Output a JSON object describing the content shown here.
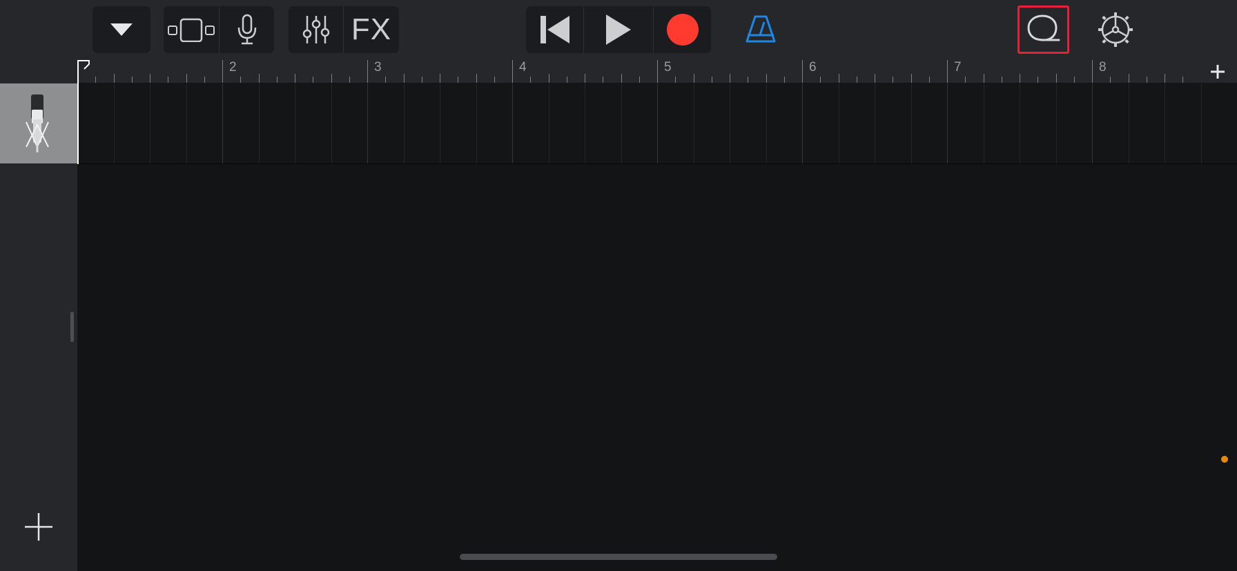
{
  "toolbar": {
    "fx_label": "FX",
    "buttons": {
      "browser": "browser-dropdown",
      "tracks_view": "tracks-view",
      "smart_control": "microphone",
      "mixer": "mixer-sliders",
      "fx": "fx",
      "rewind": "go-to-beginning",
      "play": "play",
      "record": "record",
      "metronome": "metronome",
      "loop_browser": "loop-browser",
      "settings": "settings"
    }
  },
  "ruler": {
    "bars": [
      "2",
      "3",
      "4",
      "5",
      "6",
      "7",
      "8"
    ]
  },
  "track": {
    "instrument": "microphone"
  },
  "colors": {
    "record": "#ff3b30",
    "metronome": "#1e87e6",
    "highlight": "#e8203a",
    "orange_dot": "#e5890a"
  }
}
